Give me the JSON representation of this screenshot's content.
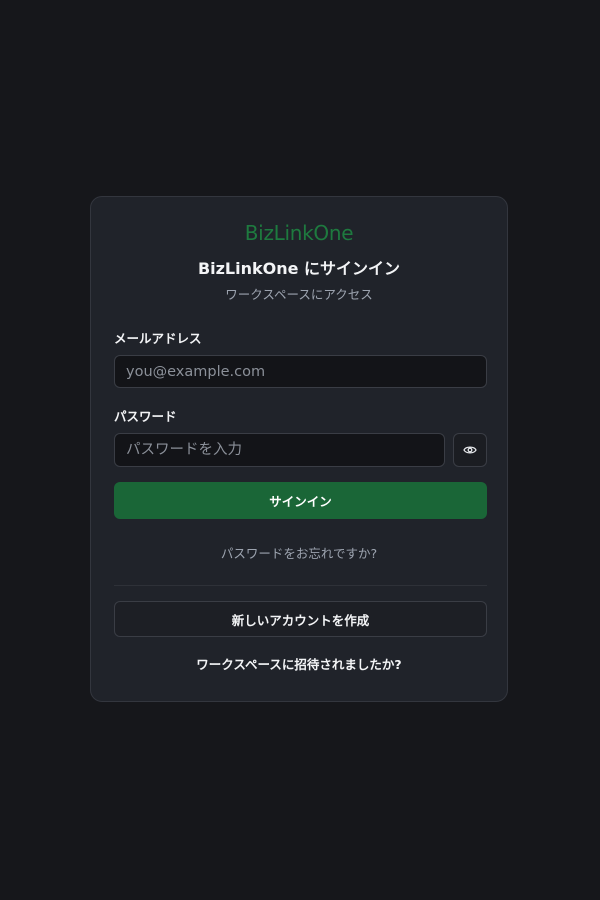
{
  "brand": {
    "logo_text": "BizLinkOne",
    "color": "#1e7a3f"
  },
  "header": {
    "title": "BizLinkOne にサインイン",
    "subtitle": "ワークスペースにアクセス"
  },
  "form": {
    "email": {
      "label": "メールアドレス",
      "placeholder": "you@example.com",
      "value": ""
    },
    "password": {
      "label": "パスワード",
      "placeholder": "パスワードを入力",
      "value": "",
      "toggle_icon": "eye-icon"
    },
    "submit_label": "サインイン",
    "forgot_password": "パスワードをお忘れですか?"
  },
  "footer": {
    "create_account_label": "新しいアカウントを作成",
    "invite_link": "ワークスペースに招待されましたか?"
  },
  "colors": {
    "background": "#16171b",
    "card": "#20232a",
    "primary": "#1a6637"
  }
}
